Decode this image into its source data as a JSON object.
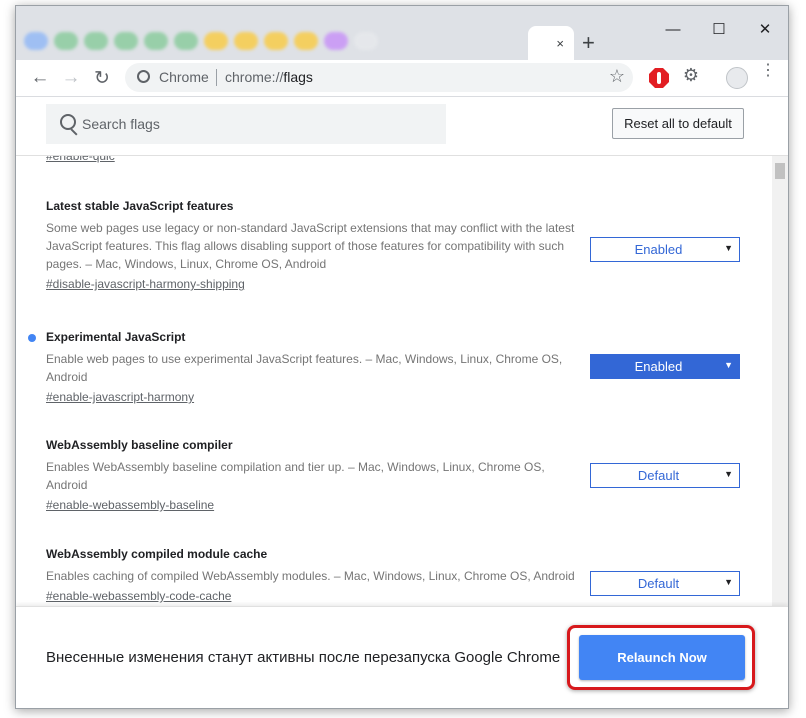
{
  "browser": {
    "tabs": {
      "blurred_tab_colors": [
        "#8ab4f8",
        "#81c995",
        "#81c995",
        "#81c995",
        "#81c995",
        "#81c995",
        "#fcc934",
        "#fcc934",
        "#fcc934",
        "#fcc934",
        "#c58af9",
        "#e8eaed"
      ],
      "active_tab_close": "×",
      "new_tab": "+"
    },
    "window_controls": {
      "minimize": "—",
      "maximize": "☐",
      "close": "✕"
    },
    "toolbar": {
      "back": "←",
      "forward": "→",
      "reload": "↻",
      "site_label": "Chrome",
      "url_prefix": "chrome://",
      "url_path": "flags",
      "bookmark_star": "☆",
      "extensions_icon": "⚙",
      "menu": "⋮"
    }
  },
  "flags_page": {
    "search": {
      "placeholder": "Search flags",
      "value": ""
    },
    "reset_button": "Reset all to default",
    "cutoff_link": "#enable-quic",
    "flags": [
      {
        "title": "Latest stable JavaScript features",
        "description": "Some web pages use legacy or non-standard JavaScript extensions that may conflict with the latest JavaScript features. This flag allows disabling support of those features for compatibility with such pages. – Mac, Windows, Linux, Chrome OS, Android",
        "link": "#disable-javascript-harmony-shipping",
        "value": "Enabled",
        "modified": false
      },
      {
        "title": "Experimental JavaScript",
        "description": "Enable web pages to use experimental JavaScript features. – Mac, Windows, Linux, Chrome OS, Android",
        "link": "#enable-javascript-harmony",
        "value": "Enabled",
        "modified": true
      },
      {
        "title": "WebAssembly baseline compiler",
        "description": "Enables WebAssembly baseline compilation and tier up. – Mac, Windows, Linux, Chrome OS, Android",
        "link": "#enable-webassembly-baseline",
        "value": "Default",
        "modified": false
      },
      {
        "title": "WebAssembly compiled module cache",
        "description": "Enables caching of compiled WebAssembly modules. – Mac, Windows, Linux, Chrome OS, Android",
        "link": "#enable-webassembly-code-cache",
        "value": "Default",
        "modified": false
      }
    ],
    "footer": {
      "message": "Внесенные изменения станут активны после перезапуска Google Chrome",
      "relaunch_button": "Relaunch Now",
      "highlight_color": "#d7191c"
    }
  },
  "colors": {
    "accent": "#3367d6",
    "button_blue": "#4285f4",
    "modified_dot": "#4285f4"
  }
}
